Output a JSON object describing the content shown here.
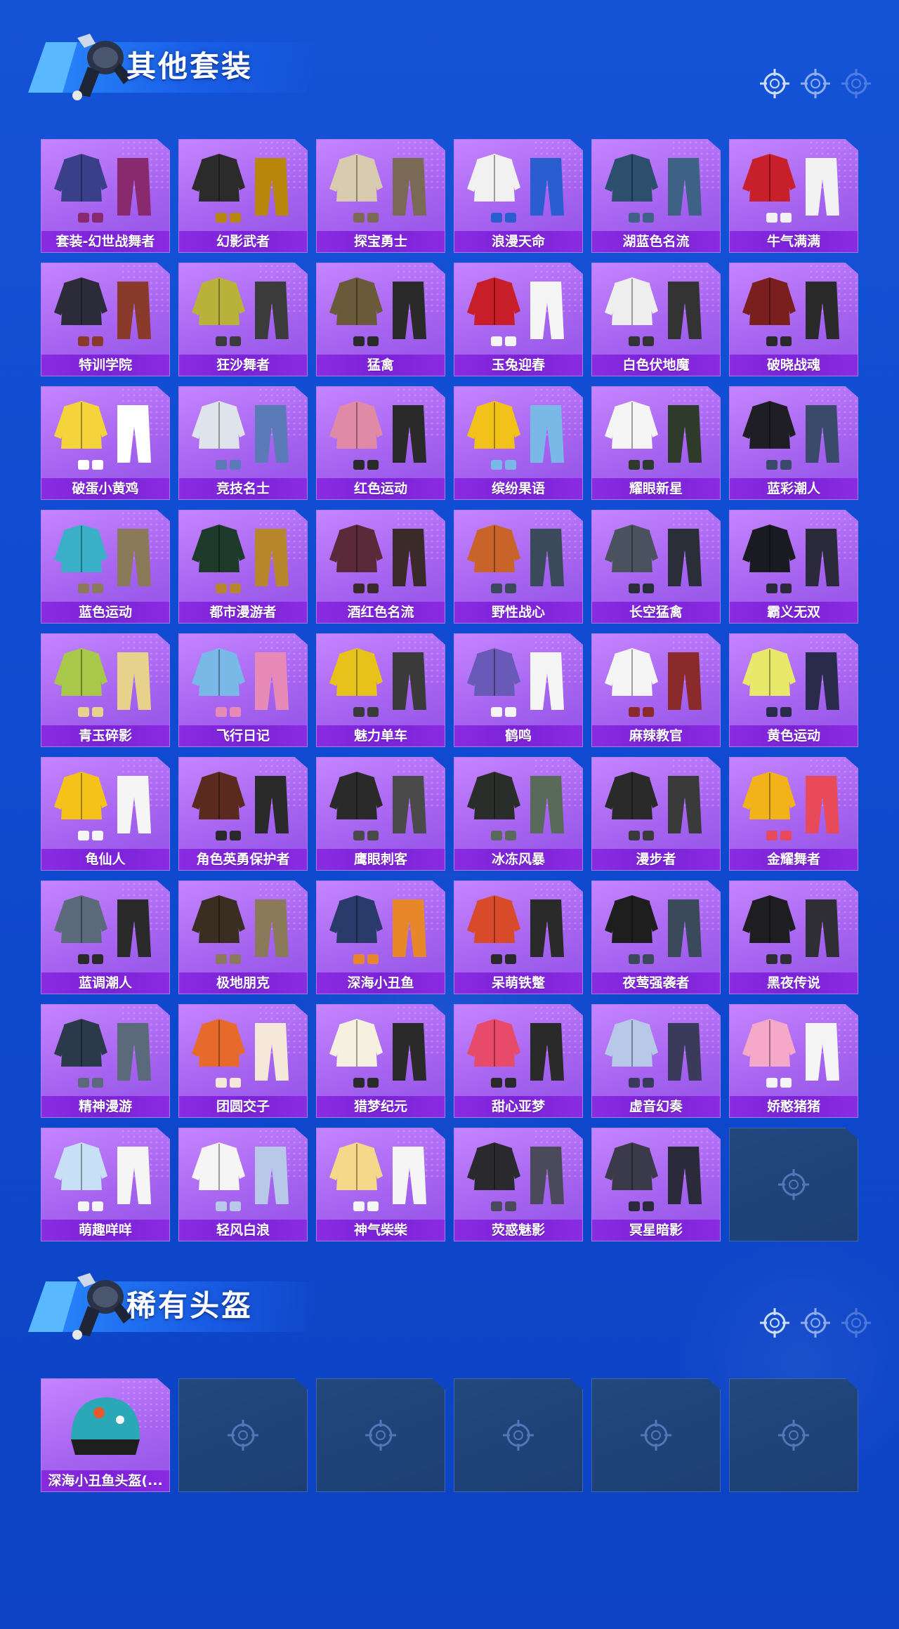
{
  "colors": {
    "background": "#1553d6",
    "card_purple": "#b074f5",
    "label_bar": "#8a2be2",
    "empty_slot": "#1f4378",
    "header_plate": "#2a8cff"
  },
  "sections": [
    {
      "title": "其他套装",
      "items": [
        {
          "label": "套装-幻世战舞者",
          "art": [
            "#3a3f8a",
            "#8a2a6e"
          ]
        },
        {
          "label": "幻影武者",
          "art": [
            "#2b2b2b",
            "#b8860b"
          ]
        },
        {
          "label": "探宝勇士",
          "art": [
            "#d9cbb0",
            "#7a6a55"
          ]
        },
        {
          "label": "浪漫天命",
          "art": [
            "#f1f1f1",
            "#2a5ed0"
          ]
        },
        {
          "label": "湖蓝色名流",
          "art": [
            "#2c4f6e",
            "#3e6285"
          ]
        },
        {
          "label": "牛气满满",
          "art": [
            "#c8202a",
            "#f2f2f2"
          ]
        },
        {
          "label": "特训学院",
          "art": [
            "#2b2b3a",
            "#8a3a2a"
          ]
        },
        {
          "label": "狂沙舞者",
          "art": [
            "#b8b23a",
            "#3b3b3b"
          ]
        },
        {
          "label": "猛禽",
          "art": [
            "#6b5a3a",
            "#2a2a2a"
          ]
        },
        {
          "label": "玉兔迎春",
          "art": [
            "#c81e2a",
            "#f5f5f5"
          ]
        },
        {
          "label": "白色伏地魔",
          "art": [
            "#eeeeee",
            "#333333"
          ]
        },
        {
          "label": "破晓战魂",
          "art": [
            "#7a1e1e",
            "#2a2a2a"
          ]
        },
        {
          "label": "破蛋小黄鸡",
          "art": [
            "#f5d33a",
            "#ffffff"
          ]
        },
        {
          "label": "竞技名士",
          "art": [
            "#dfe4ec",
            "#5a7ab8"
          ]
        },
        {
          "label": "红色运动",
          "art": [
            "#e08aa8",
            "#2a2a2a"
          ]
        },
        {
          "label": "缤纷果语",
          "art": [
            "#f2c21a",
            "#7ab8e8"
          ]
        },
        {
          "label": "耀眼新星",
          "art": [
            "#f5f5f5",
            "#2e3a2a"
          ]
        },
        {
          "label": "蓝彩潮人",
          "art": [
            "#1e1e24",
            "#3a4a6a"
          ]
        },
        {
          "label": "蓝色运动",
          "art": [
            "#3ab0c8",
            "#8a7a5a"
          ]
        },
        {
          "label": "都市漫游者",
          "art": [
            "#1e3a2a",
            "#b8862a"
          ]
        },
        {
          "label": "酒红色名流",
          "art": [
            "#5a2a3a",
            "#3a2a2a"
          ]
        },
        {
          "label": "野性战心",
          "art": [
            "#c8642a",
            "#3a4a5a"
          ]
        },
        {
          "label": "长空猛禽",
          "art": [
            "#4a5260",
            "#2a2e38"
          ]
        },
        {
          "label": "霸义无双",
          "art": [
            "#1a1a22",
            "#2a2a3a"
          ]
        },
        {
          "label": "青玉碎影",
          "art": [
            "#a8c84a",
            "#e6d28a"
          ]
        },
        {
          "label": "飞行日记",
          "art": [
            "#7ab8e8",
            "#e88ab8"
          ]
        },
        {
          "label": "魅力单车",
          "art": [
            "#e6c21a",
            "#3a3a3a"
          ]
        },
        {
          "label": "鹤鸣",
          "art": [
            "#6a5ab8",
            "#f5f5f5"
          ]
        },
        {
          "label": "麻辣教官",
          "art": [
            "#f5f5f5",
            "#8a2a2a"
          ]
        },
        {
          "label": "黄色运动",
          "art": [
            "#e8e86a",
            "#2a2a4a"
          ]
        },
        {
          "label": "龟仙人",
          "art": [
            "#f5c21a",
            "#f5f5f5"
          ]
        },
        {
          "label": "角色英勇保护者",
          "art": [
            "#5a2a1e",
            "#2a2a2a"
          ]
        },
        {
          "label": "鹰眼刺客",
          "art": [
            "#2a2a2a",
            "#4a4a4a"
          ]
        },
        {
          "label": "冰冻风暴",
          "art": [
            "#2a2e2a",
            "#5a6a5a"
          ]
        },
        {
          "label": "漫步者",
          "art": [
            "#2a2a2a",
            "#3a3a3a"
          ]
        },
        {
          "label": "金耀舞者",
          "art": [
            "#f2b21a",
            "#e84a5a"
          ]
        },
        {
          "label": "蓝调潮人",
          "art": [
            "#5a6a7a",
            "#2a2a2a"
          ]
        },
        {
          "label": "极地朋克",
          "art": [
            "#3a2e22",
            "#8a7a5a"
          ]
        },
        {
          "label": "深海小丑鱼",
          "art": [
            "#2a3a6a",
            "#e8862a"
          ]
        },
        {
          "label": "呆萌铁蹩",
          "art": [
            "#d84a2a",
            "#2a2a2a"
          ]
        },
        {
          "label": "夜莺强袭者",
          "art": [
            "#1e1e1e",
            "#3a4a5a"
          ]
        },
        {
          "label": "黑夜传说",
          "art": [
            "#1e1e22",
            "#2e2e34"
          ]
        },
        {
          "label": "精神漫游",
          "art": [
            "#2a3a4a",
            "#5a6a7a"
          ]
        },
        {
          "label": "团圆交子",
          "art": [
            "#e86a2a",
            "#f5e8d8"
          ]
        },
        {
          "label": "猎梦纪元",
          "art": [
            "#f5f0e0",
            "#2a2a2a"
          ]
        },
        {
          "label": "甜心亚梦",
          "art": [
            "#e84a6a",
            "#2a2a2a"
          ]
        },
        {
          "label": "虚音幻奏",
          "art": [
            "#b8c8e8",
            "#3a3a5a"
          ]
        },
        {
          "label": "娇憨猪猪",
          "art": [
            "#f5a8c8",
            "#f5f5f5"
          ]
        },
        {
          "label": "萌趣咩咩",
          "art": [
            "#c8e0f5",
            "#f5f5f5"
          ]
        },
        {
          "label": "轻风白浪",
          "art": [
            "#f5f5f5",
            "#b8c8e8"
          ]
        },
        {
          "label": "神气柴柴",
          "art": [
            "#f5d88a",
            "#f5f5f5"
          ]
        },
        {
          "label": "荧惑魅影",
          "art": [
            "#2a2a2e",
            "#4a4a5a"
          ]
        },
        {
          "label": "冥星暗影",
          "art": [
            "#3a3a4a",
            "#2a2a3a"
          ]
        },
        {
          "label": "",
          "empty": true
        }
      ]
    },
    {
      "title": "稀有头盔",
      "items": [
        {
          "label": "深海小丑鱼头盔(...",
          "art": [
            "#2aa8b8",
            "#1e1e1e"
          ],
          "helmet": true
        },
        {
          "label": "",
          "empty": true
        },
        {
          "label": "",
          "empty": true
        },
        {
          "label": "",
          "empty": true
        },
        {
          "label": "",
          "empty": true
        },
        {
          "label": "",
          "empty": true
        }
      ]
    }
  ]
}
